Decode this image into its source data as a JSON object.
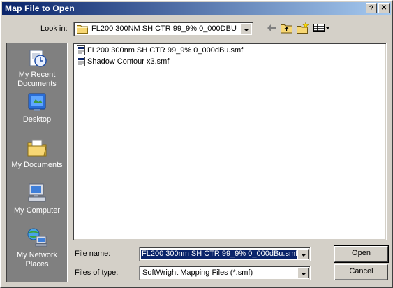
{
  "window": {
    "title": "Map File to Open",
    "help_button": "?",
    "close_button": "✕"
  },
  "lookin": {
    "label": "Look in:",
    "value": "FL200 300NM SH CTR 99_9% 0_000DBU"
  },
  "places": [
    {
      "label": "My Recent Documents",
      "icon": "recent-documents-icon"
    },
    {
      "label": "Desktop",
      "icon": "desktop-icon"
    },
    {
      "label": "My Documents",
      "icon": "my-documents-icon"
    },
    {
      "label": "My Computer",
      "icon": "my-computer-icon"
    },
    {
      "label": "My Network Places",
      "icon": "network-places-icon"
    }
  ],
  "files": [
    {
      "name": "FL200 300nm SH CTR 99_9% 0_000dBu.smf",
      "icon": "map-file-icon"
    },
    {
      "name": "Shadow Contour x3.smf",
      "icon": "map-file-icon"
    }
  ],
  "filename": {
    "label": "File name:",
    "value": "FL200 300nm SH CTR 99_9% 0_000dBu.smf"
  },
  "filetype": {
    "label": "Files of type:",
    "value": "SoftWright Mapping Files (*.smf)"
  },
  "buttons": {
    "open": "Open",
    "cancel": "Cancel"
  }
}
